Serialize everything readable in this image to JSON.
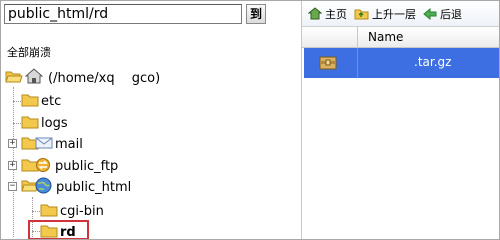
{
  "window": {
    "title": ""
  },
  "path_bar": {
    "value": "public_html/rd",
    "go_label": "到"
  },
  "tree": {
    "header": "全部崩溃",
    "root_label": "(/home/xq   gco)",
    "items": [
      {
        "label": "etc"
      },
      {
        "label": "logs"
      },
      {
        "label": "mail"
      },
      {
        "label": "public_ftp"
      },
      {
        "label": "public_html"
      },
      {
        "label": "cgi-bin"
      },
      {
        "label": "rd"
      }
    ]
  },
  "toolbar": {
    "home": "主页",
    "up": "上升一层",
    "back": "后退"
  },
  "file_list": {
    "column_name": "Name",
    "rows": [
      {
        "name": "        .tar.gz",
        "selected": true
      }
    ]
  },
  "colors": {
    "selection": "#3d6ee2",
    "highlight_border": "#d2323c",
    "folder": "#f2c94c"
  }
}
